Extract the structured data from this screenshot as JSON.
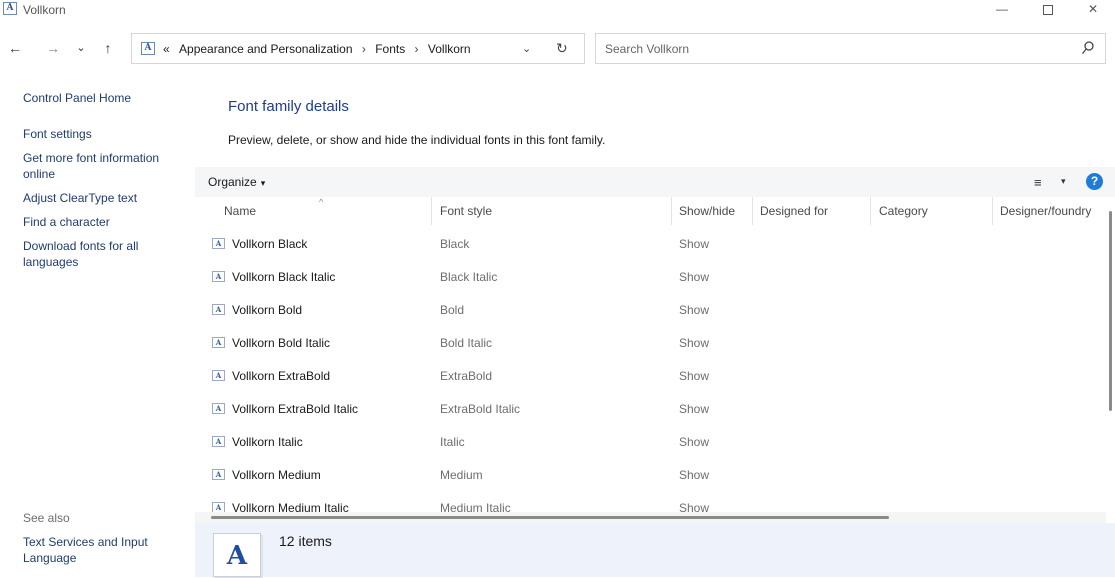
{
  "window": {
    "title": "Vollkorn",
    "icon_letter": "A",
    "minimize_glyph": "—",
    "close_glyph": "✕"
  },
  "nav": {
    "back_glyph": "←",
    "forward_glyph": "→",
    "recent_glyph": "⌄",
    "up_glyph": "↑",
    "overflow": "«",
    "breadcrumbs": [
      "Appearance and Personalization",
      "Fonts",
      "Vollkorn"
    ],
    "breadcrumb_separator": "›",
    "dropdown_glyph": "⌄",
    "refresh_glyph": "↻"
  },
  "search": {
    "placeholder": "Search Vollkorn"
  },
  "sidebar": {
    "links": [
      "Control Panel Home",
      "Font settings",
      "Get more font information online",
      "Adjust ClearType text",
      "Find a character",
      "Download fonts for all languages"
    ],
    "see_also_label": "See also",
    "see_also_links": [
      "Text Services and Input Language"
    ]
  },
  "main": {
    "title": "Font family details",
    "description": "Preview, delete, or show and hide the individual fonts in this font family."
  },
  "toolbar": {
    "organize_label": "Organize",
    "caret": "▾",
    "view_glyph": "≡",
    "help_glyph": "?"
  },
  "columns": [
    "Name",
    "Font style",
    "Show/hide",
    "Designed for",
    "Category",
    "Designer/foundry"
  ],
  "sort_arrow": "^",
  "fonts": [
    {
      "name": "Vollkorn Black",
      "style": "Black",
      "show": "Show"
    },
    {
      "name": "Vollkorn Black Italic",
      "style": "Black Italic",
      "show": "Show"
    },
    {
      "name": "Vollkorn Bold",
      "style": "Bold",
      "show": "Show"
    },
    {
      "name": "Vollkorn Bold Italic",
      "style": "Bold Italic",
      "show": "Show"
    },
    {
      "name": "Vollkorn ExtraBold",
      "style": "ExtraBold",
      "show": "Show"
    },
    {
      "name": "Vollkorn ExtraBold Italic",
      "style": "ExtraBold Italic",
      "show": "Show"
    },
    {
      "name": "Vollkorn Italic",
      "style": "Italic",
      "show": "Show"
    },
    {
      "name": "Vollkorn Medium",
      "style": "Medium",
      "show": "Show"
    },
    {
      "name": "Vollkorn Medium Italic",
      "style": "Medium Italic",
      "show": "Show"
    }
  ],
  "details": {
    "icon_letter": "A",
    "count": "12 items"
  },
  "colors": {
    "link": "#1f3c6e",
    "title": "#1e3d8f",
    "help": "#1e7bd6",
    "details_bg": "#eef3fb"
  }
}
